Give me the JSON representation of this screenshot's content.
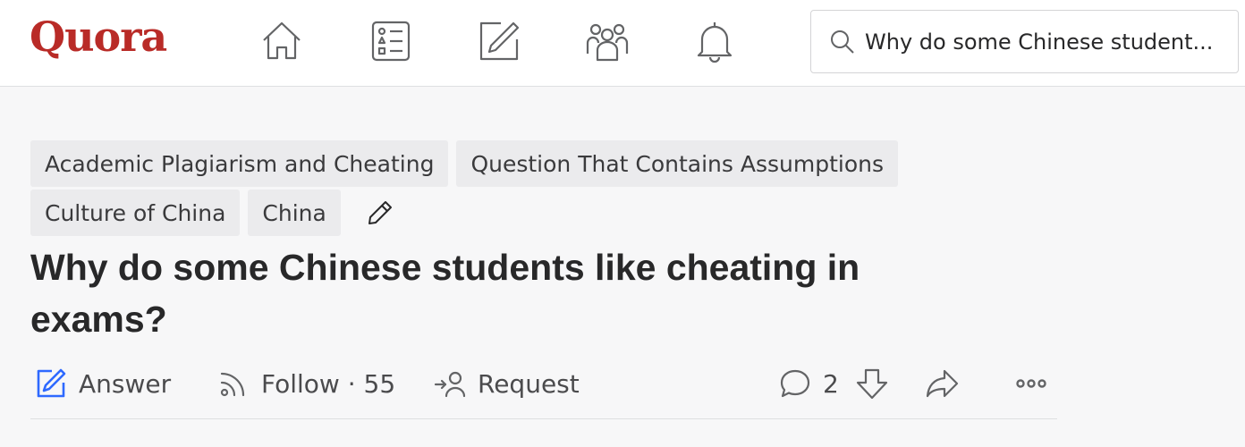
{
  "brand": {
    "logo_text": "Quora",
    "color": "#b92b27"
  },
  "nav": [
    {
      "name": "home-icon"
    },
    {
      "name": "answer-list-icon"
    },
    {
      "name": "write-icon"
    },
    {
      "name": "spaces-icon"
    },
    {
      "name": "bell-icon"
    }
  ],
  "search": {
    "value": "Why do some Chinese student..."
  },
  "topics": {
    "row1": [
      "Academic Plagiarism and Cheating",
      "Question That Contains Assumptions"
    ],
    "row2": [
      "Culture of China",
      "China"
    ]
  },
  "question": {
    "title": "Why do some Chinese students like cheating in exams?"
  },
  "actions": {
    "answer_label": "Answer",
    "follow_label": "Follow · 55",
    "request_label": "Request",
    "comment_count": "2"
  },
  "colors": {
    "accent_blue": "#2e69ff",
    "icon_gray": "#636466"
  }
}
